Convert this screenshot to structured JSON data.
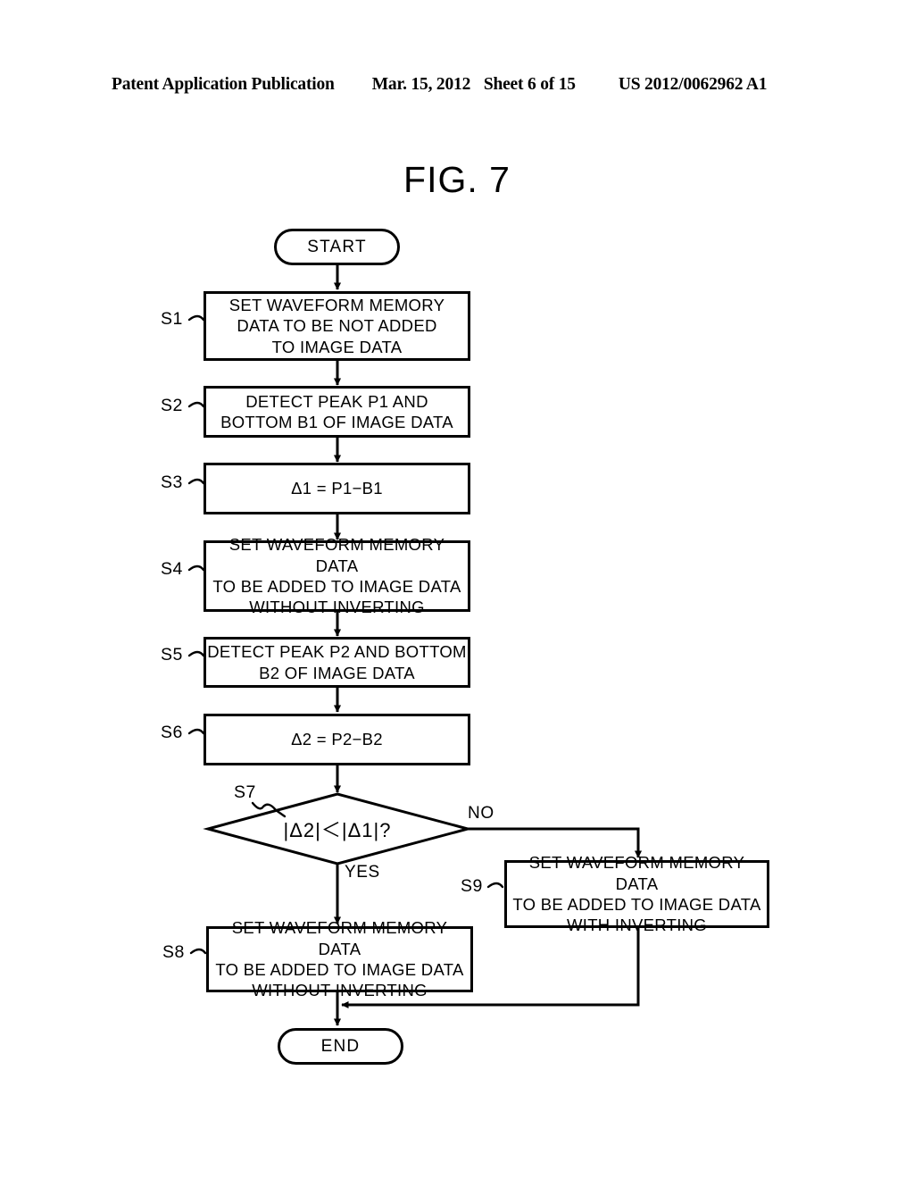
{
  "header": {
    "left": "Patent Application Publication",
    "date": "Mar. 15, 2012",
    "sheet": "Sheet 6 of 15",
    "publication_number": "US 2012/0062962 A1"
  },
  "figure": {
    "title": "FIG. 7"
  },
  "flowchart": {
    "start": {
      "label": "START"
    },
    "end": {
      "label": "END"
    },
    "steps": [
      {
        "id": "S1",
        "tag": "S1",
        "text": "SET WAVEFORM MEMORY\nDATA TO BE NOT ADDED\nTO IMAGE DATA"
      },
      {
        "id": "S2",
        "tag": "S2",
        "text": "DETECT PEAK P1 AND\nBOTTOM B1 OF IMAGE DATA"
      },
      {
        "id": "S3",
        "tag": "S3",
        "text": "Δ1 = P1−B1"
      },
      {
        "id": "S4",
        "tag": "S4",
        "text": "SET WAVEFORM MEMORY DATA\nTO BE ADDED TO IMAGE DATA\nWITHOUT INVERTING"
      },
      {
        "id": "S5",
        "tag": "S5",
        "text": "DETECT PEAK P2 AND BOTTOM\nB2 OF IMAGE DATA"
      },
      {
        "id": "S6",
        "tag": "S6",
        "text": "Δ2 = P2−B2"
      },
      {
        "id": "S7",
        "tag": "S7",
        "text": "|Δ2|＜|Δ1|?"
      },
      {
        "id": "S8",
        "tag": "S8",
        "text": "SET WAVEFORM MEMORY DATA\nTO BE ADDED TO IMAGE DATA\nWITHOUT INVERTING"
      },
      {
        "id": "S9",
        "tag": "S9",
        "text": "SET WAVEFORM MEMORY DATA\nTO BE ADDED TO IMAGE DATA\nWITH INVERTING"
      }
    ],
    "branches": {
      "yes": "YES",
      "no": "NO"
    }
  },
  "colors": {
    "ink": "#000000",
    "paper": "#ffffff"
  }
}
